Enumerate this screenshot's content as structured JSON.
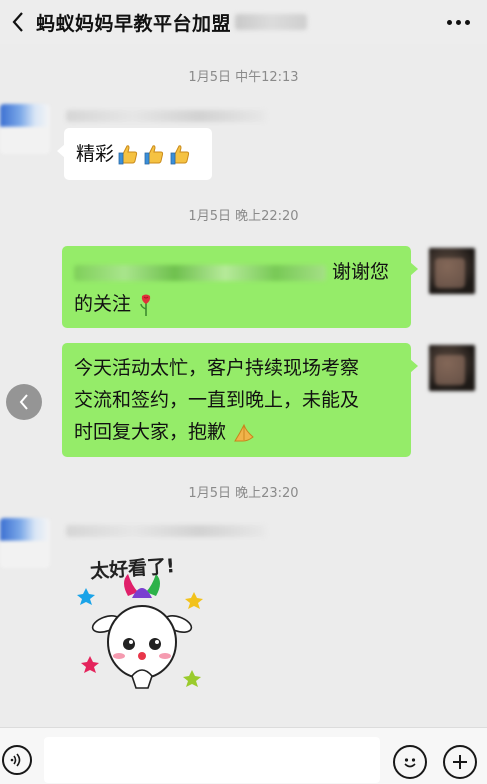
{
  "header": {
    "title": "蚂蚁妈妈早教平台加盟",
    "back_icon": "chevron-left-icon",
    "more_icon": "more-dots-icon"
  },
  "messages": [
    {
      "timestamp": "1月5日 中午12:13",
      "side": "left",
      "text": "精彩",
      "emoji": "thumbs-up-icon x3"
    },
    {
      "timestamp": "1月5日 晚上22:20",
      "side": "right",
      "text": "谢谢您的关注",
      "line1_tail": "谢谢您",
      "line2": "的关注",
      "emoji": "rose-icon"
    },
    {
      "side": "right",
      "line1": "今天活动太忙，客户持续现场考察",
      "line2": "交流和签约，一直到晚上，未能及",
      "line3": "时回复大家，抱歉",
      "emoji": "pray-hands-icon"
    },
    {
      "timestamp": "1月5日 晚上23:20",
      "side": "left",
      "sticker_text": "太好看了!",
      "sticker_icon": "cartoon-sticker"
    }
  ],
  "input_bar": {
    "placeholder": "",
    "voice_icon": "voice-icon",
    "emoji_icon": "smile-icon",
    "plus_icon": "plus-icon"
  },
  "colors": {
    "sent_bubble": "#95ec69",
    "received_bubble": "#ffffff",
    "background": "#ececec"
  }
}
